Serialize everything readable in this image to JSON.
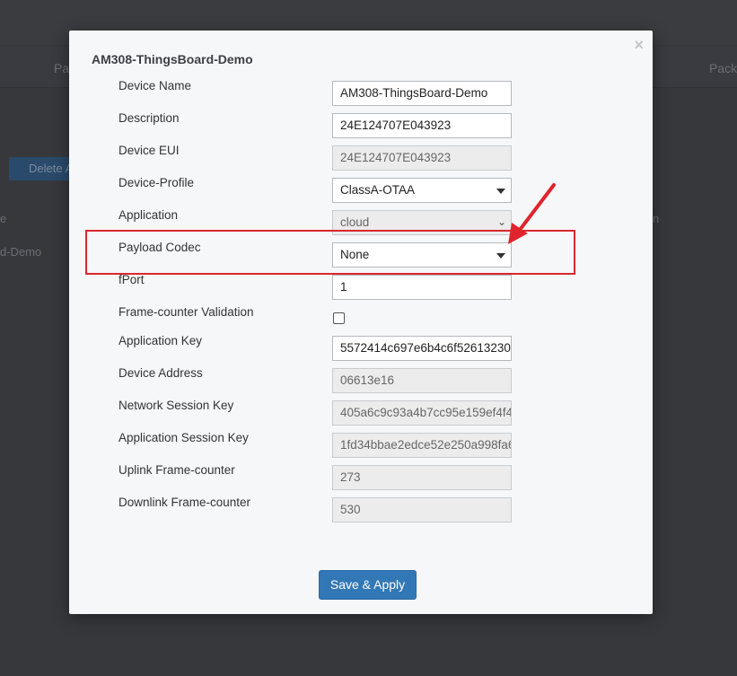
{
  "background": {
    "tabs": [
      "Pa",
      "Pack"
    ],
    "delete_button": "Delete A",
    "header_left": "e",
    "header_right": "n",
    "row_text": "d-Demo"
  },
  "modal": {
    "title": "AM308-ThingsBoard-Demo",
    "close_symbol": "×",
    "fields": {
      "device_name": {
        "label": "Device Name",
        "value": "AM308-ThingsBoard-Demo"
      },
      "description": {
        "label": "Description",
        "value": "24E124707E043923"
      },
      "device_eui": {
        "label": "Device EUI",
        "value": "24E124707E043923"
      },
      "device_profile": {
        "label": "Device-Profile",
        "value": "ClassA-OTAA"
      },
      "application": {
        "label": "Application",
        "value": "cloud"
      },
      "payload_codec": {
        "label": "Payload Codec",
        "value": "None"
      },
      "fport": {
        "label": "fPort",
        "value": "1"
      },
      "frame_counter_validation": {
        "label": "Frame-counter Validation",
        "checked": false
      },
      "application_key": {
        "label": "Application Key",
        "value": "5572414c697e6b4c6f52613230"
      },
      "device_address": {
        "label": "Device Address",
        "value": "06613e16"
      },
      "network_session_key": {
        "label": "Network Session Key",
        "value": "405a6c9c93a4b7cc95e159ef4f4"
      },
      "application_session_key": {
        "label": "Application Session Key",
        "value": "1fd34bbae2edce52e250a998fa6"
      },
      "uplink_frame_counter": {
        "label": "Uplink Frame-counter",
        "value": "273"
      },
      "downlink_frame_counter": {
        "label": "Downlink Frame-counter",
        "value": "530"
      }
    },
    "save_button": "Save & Apply"
  },
  "colors": {
    "accent": "#3278b6",
    "annotation": "#d9282f"
  }
}
